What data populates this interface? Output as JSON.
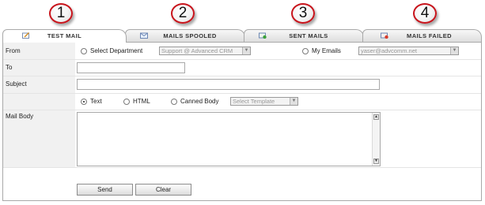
{
  "callouts": [
    "1",
    "2",
    "3",
    "4"
  ],
  "tabs": [
    {
      "label": "TEST MAIL",
      "icon": "compose-icon"
    },
    {
      "label": "MAILS SPOOLED",
      "icon": "spooled-mail-icon"
    },
    {
      "label": "SENT MAILS",
      "icon": "sent-mail-icon"
    },
    {
      "label": "MAILS FAILED",
      "icon": "failed-mail-icon"
    }
  ],
  "form": {
    "from_label": "From",
    "to_label": "To",
    "subject_label": "Subject",
    "body_label": "Mail Body",
    "select_department": "Select Department",
    "department_value": "Support @ Advanced CRM",
    "my_emails": "My Emails",
    "my_emails_value": "yaser@advcomm.net",
    "format_text": "Text",
    "format_html": "HTML",
    "format_canned": "Canned Body",
    "template_value": "Select Template"
  },
  "buttons": {
    "send": "Send",
    "clear": "Clear"
  },
  "colors": {
    "callout_border": "#c8141c",
    "panel_border": "#a9a9a9",
    "label_bg": "#f1f1f1"
  }
}
